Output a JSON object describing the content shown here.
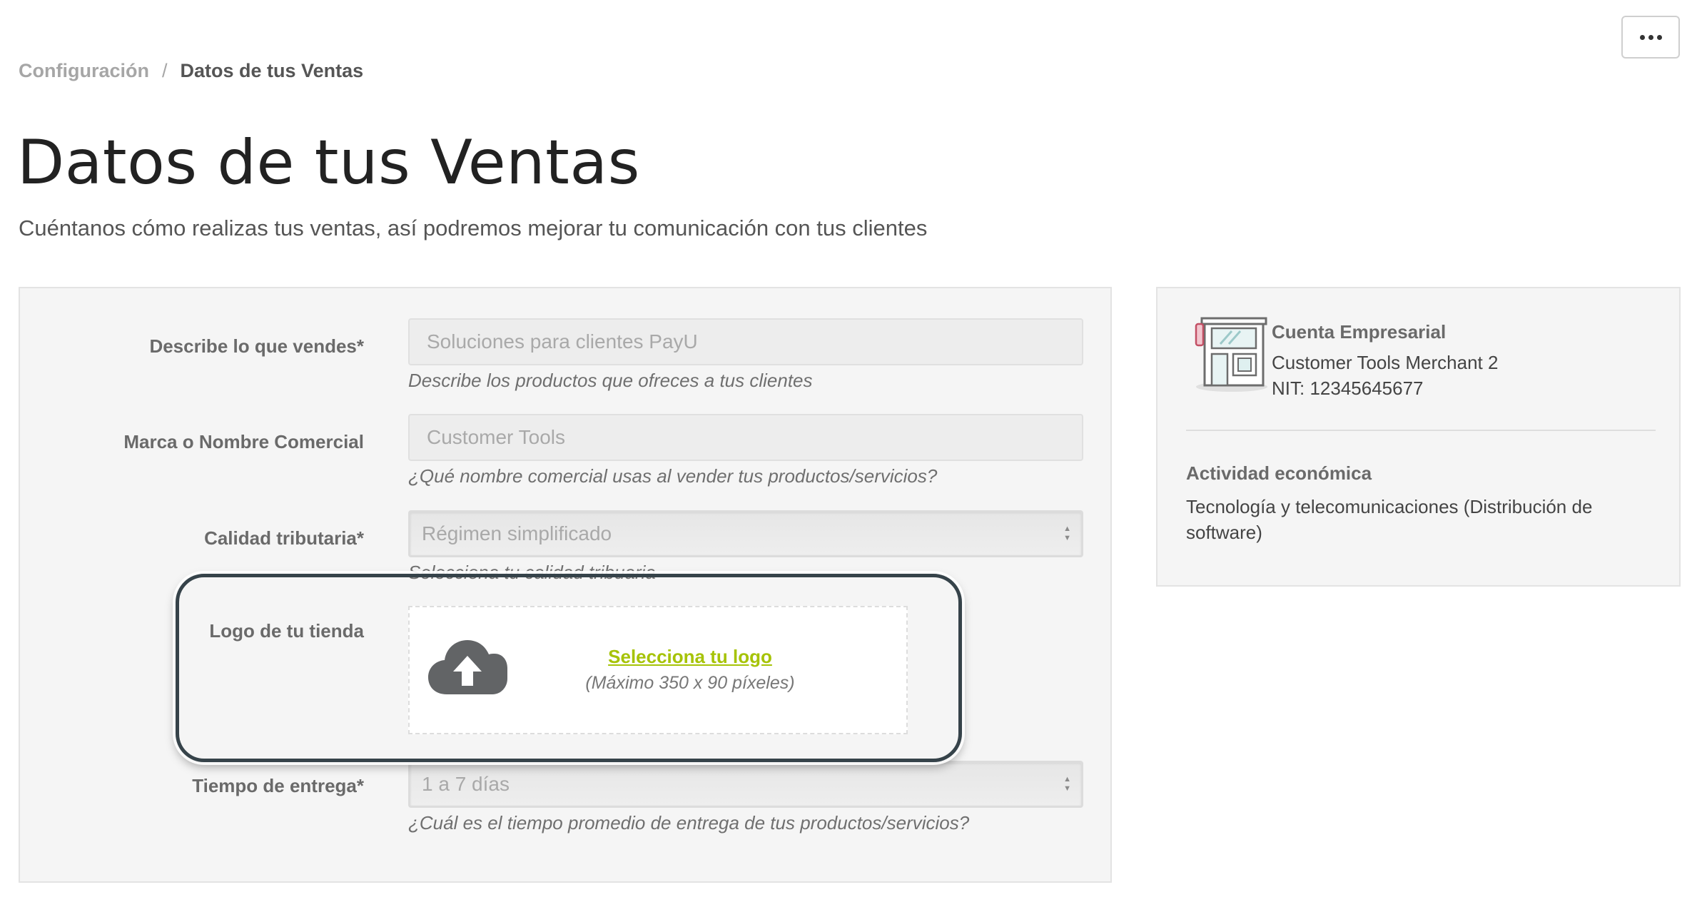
{
  "menu": {
    "icon": "more-horizontal-icon"
  },
  "breadcrumb": {
    "parent": "Configuración",
    "separator": "/",
    "current": "Datos de tus Ventas"
  },
  "page": {
    "title": "Datos de tus Ventas",
    "subtitle": "Cuéntanos cómo realizas tus ventas, así podremos mejorar tu comunicación con tus clientes"
  },
  "form": {
    "describe": {
      "label": "Describe lo que vendes*",
      "value": "Soluciones para clientes PayU",
      "help": "Describe los productos que ofreces a tus clientes"
    },
    "brand": {
      "label": "Marca o Nombre Comercial",
      "value": "Customer Tools",
      "help": "¿Qué nombre comercial usas al vender tus productos/servicios?"
    },
    "tax": {
      "label": "Calidad tributaria*",
      "value": "Régimen simplificado",
      "help": "Selecciona tu calidad tribuaria"
    },
    "logo": {
      "label": "Logo de tu tienda",
      "link": "Selecciona tu logo",
      "hint": "(Máximo 350 x 90 píxeles)",
      "icon": "cloud-upload-icon"
    },
    "delivery": {
      "label": "Tiempo de entrega*",
      "value": "1 a 7 días",
      "help": "¿Cuál es el tiempo promedio de entrega de tus productos/servicios?"
    }
  },
  "account": {
    "icon": "storefront-icon",
    "title": "Cuenta Empresarial",
    "name": "Customer Tools Merchant 2",
    "nit": "NIT: 12345645677",
    "activity_title": "Actividad económica",
    "activity_value": "Tecnología y telecomunicaciones (Distribución de software)"
  },
  "colors": {
    "accent": "#a6c307",
    "highlight": "#36434a",
    "panel": "#f5f5f5"
  }
}
